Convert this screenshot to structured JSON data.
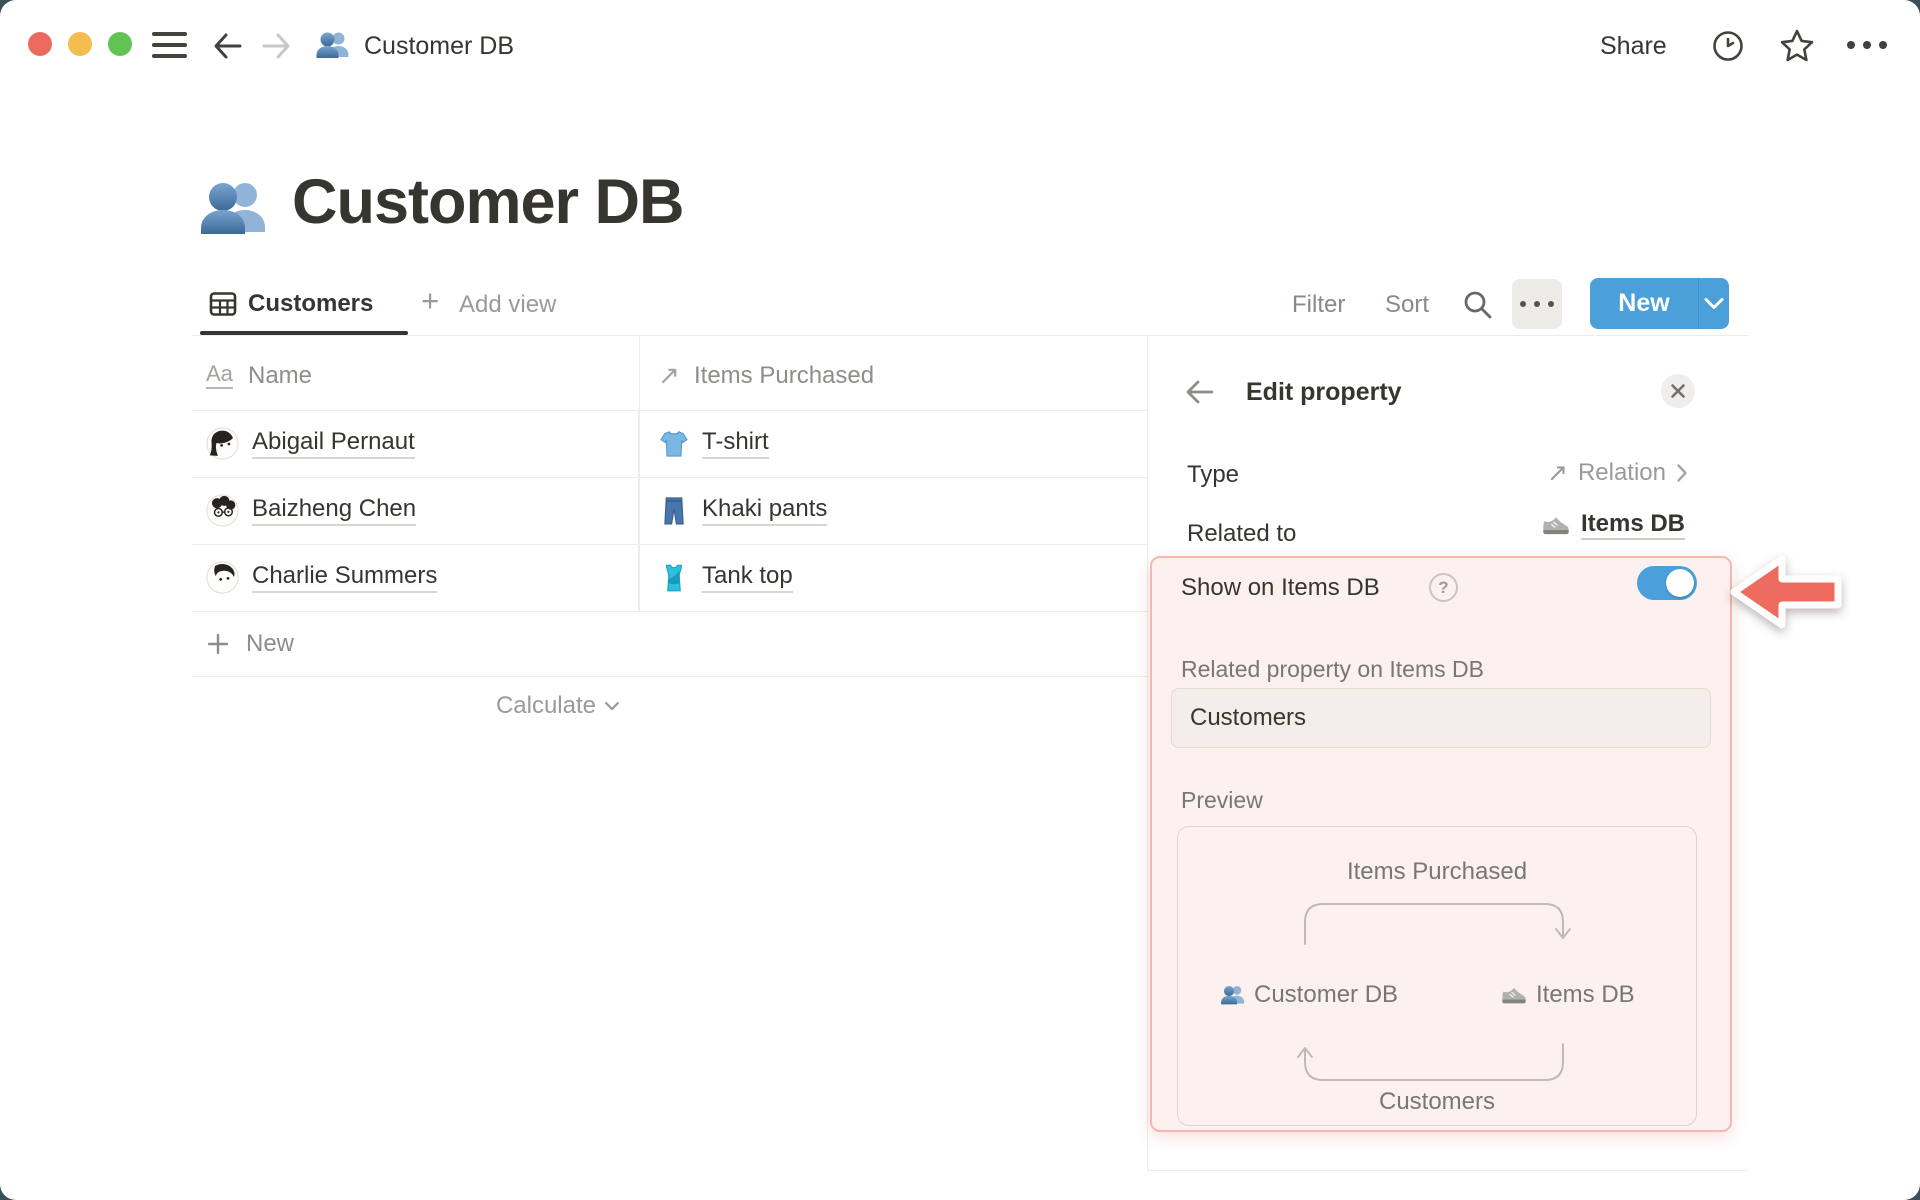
{
  "topbar": {
    "title": "Customer DB",
    "share": "Share"
  },
  "page": {
    "title": "Customer DB"
  },
  "view_bar": {
    "active_tab": "Customers",
    "add_view": "Add view",
    "filter": "Filter",
    "sort": "Sort",
    "new_button": "New"
  },
  "table": {
    "columns": [
      {
        "label": "Name"
      },
      {
        "label": "Items Purchased"
      }
    ],
    "rows": [
      {
        "name": "Abigail Pernaut",
        "item": "T-shirt"
      },
      {
        "name": "Baizheng Chen",
        "item": "Khaki pants"
      },
      {
        "name": "Charlie Summers",
        "item": "Tank top"
      }
    ],
    "new_row_label": "New",
    "calculate_label": "Calculate"
  },
  "panel": {
    "title": "Edit property",
    "type_label": "Type",
    "type_value": "Relation",
    "related_to_label": "Related to",
    "related_to_value": "Items DB",
    "show_on_label": "Show on Items DB",
    "toggle_on": true,
    "related_property_label": "Related property on Items DB",
    "related_property_value": "Customers",
    "preview_label": "Preview",
    "preview": {
      "top_label": "Items Purchased",
      "left_node": "Customer DB",
      "right_node": "Items DB",
      "bottom_label": "Customers"
    }
  },
  "glyphs": {
    "aa": "Aa",
    "relation_arrow": "↗",
    "plus": "+",
    "question": "?"
  },
  "colors": {
    "accent_blue": "#4BA0D9",
    "highlight_pink_bg": "#FCF1EE",
    "highlight_pink_border": "#F3B8B1",
    "annotation_red": "#ED6B5F",
    "traffic_red": "#ED6A5E",
    "traffic_yellow": "#F5BD4F",
    "traffic_green": "#61C454"
  }
}
